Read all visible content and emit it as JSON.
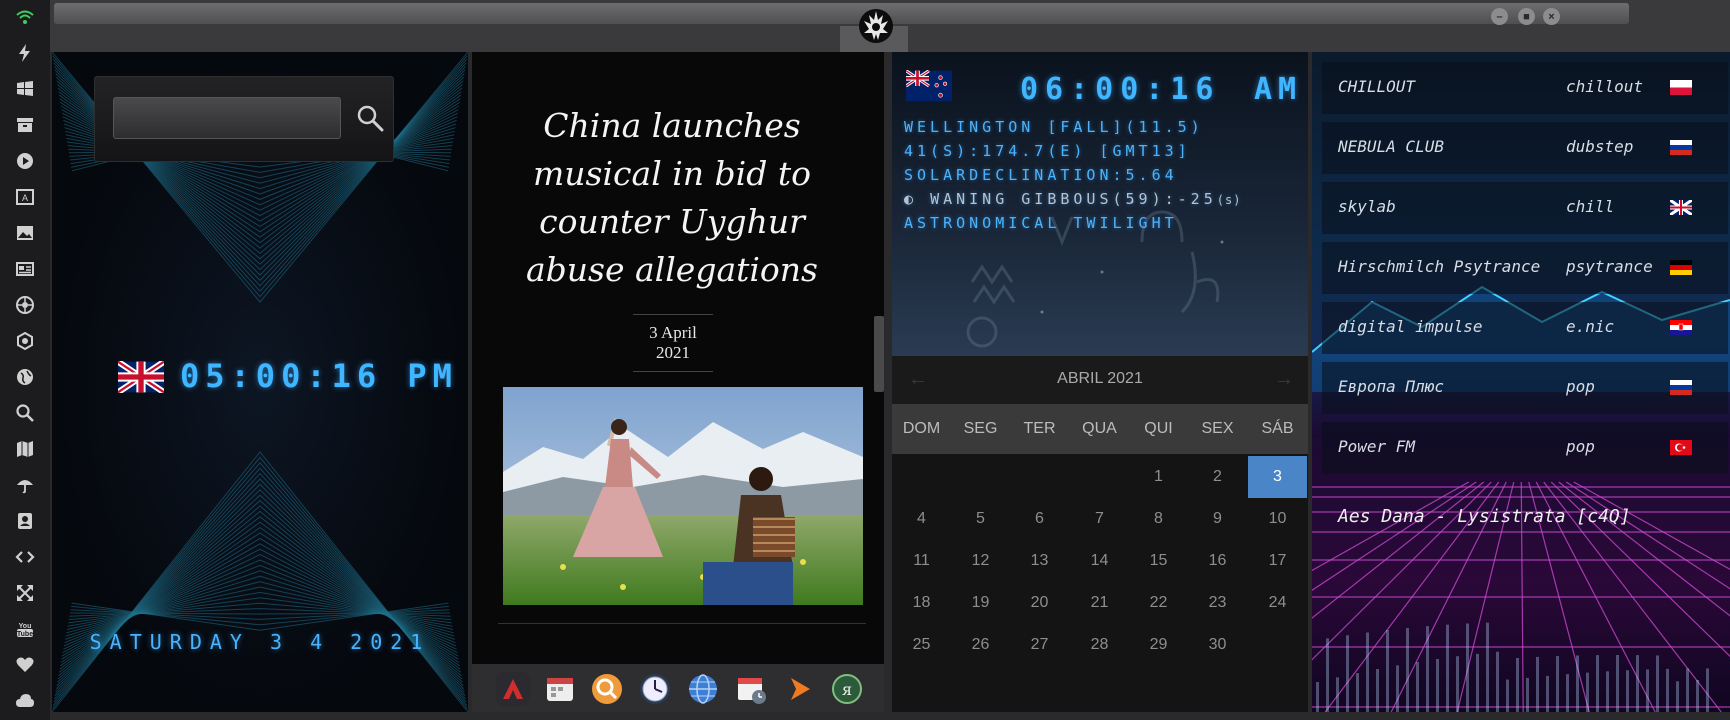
{
  "rail": {
    "icons": [
      "wifi-icon",
      "bolt-icon",
      "windows-icon",
      "archive-icon",
      "play-icon",
      "maps-icon",
      "image-icon",
      "news-icon",
      "shutter-icon",
      "hexagon-icon",
      "globe-icon",
      "search-icon",
      "map-icon",
      "umbrella-icon",
      "contacts-icon",
      "code-icon",
      "expand-icon",
      "youtube-icon",
      "heart-icon",
      "cloud-icon"
    ]
  },
  "world_clock": {
    "search_placeholder": "",
    "time": "05:00:16  PM",
    "date": "SATURDAY 3 4 2021"
  },
  "news": {
    "title": "China launches musical in bid to counter Uyghur abuse allegations",
    "date": "3 April 2021"
  },
  "astro": {
    "time": "06:00:16",
    "ampm": "AM",
    "line1": "WELLINGTON [FALL](11.5)",
    "line2": "41(S):174.7(E) [GMT13]",
    "line3": "SOLARDECLINATION:5.64",
    "moon": "WANING GIBBOUS(59):-25",
    "moon_suffix": "(s)",
    "line5": "ASTRONOMICAL TWILIGHT"
  },
  "calendar": {
    "month": "ABRIL 2021",
    "prev": "←",
    "next": "→",
    "weekdays": [
      "DOM",
      "SEG",
      "TER",
      "QUA",
      "QUI",
      "SEX",
      "SÁB"
    ],
    "selected_day": 3,
    "weeks": [
      [
        "",
        "",
        "",
        "",
        "1",
        "2",
        "3"
      ],
      [
        "4",
        "5",
        "6",
        "7",
        "8",
        "9",
        "10"
      ],
      [
        "11",
        "12",
        "13",
        "14",
        "15",
        "16",
        "17"
      ],
      [
        "18",
        "19",
        "20",
        "21",
        "22",
        "23",
        "24"
      ],
      [
        "25",
        "26",
        "27",
        "28",
        "29",
        "30",
        ""
      ]
    ]
  },
  "radio": {
    "stations": [
      {
        "name": "CHILLOUT",
        "genre": "chillout",
        "flag": "pl"
      },
      {
        "name": "NEBULA CLUB",
        "genre": "dubstep",
        "flag": "ru"
      },
      {
        "name": "skylab",
        "genre": "chill",
        "flag": "uk"
      },
      {
        "name": "Hirschmilch Psytrance",
        "genre": "psytrance",
        "flag": "de"
      },
      {
        "name": "digital impulse",
        "genre": "e.nic",
        "flag": "hr"
      },
      {
        "name": "Европа Плюс",
        "genre": "pop",
        "flag": "ru"
      },
      {
        "name": "Power FM",
        "genre": "pop",
        "flag": "tr"
      }
    ],
    "now_playing": "Aes Dana - Lysistrata [c4Q]"
  },
  "dock": {
    "icons": [
      "app-store-icon",
      "calendar-app-icon",
      "search-app-icon",
      "clock-app-icon",
      "browser-icon",
      "calendar-icon",
      "media-player-icon",
      "yandex-icon"
    ]
  },
  "colors": {
    "lcd": "#3fb6ff",
    "calendar_selected": "#4a86c7",
    "accent_wifi": "#3dcc5f"
  }
}
